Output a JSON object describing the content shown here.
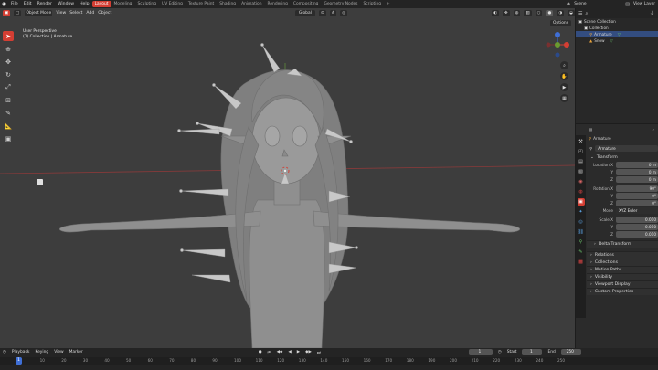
{
  "topbar": {
    "menus": [
      "File",
      "Edit",
      "Render",
      "Window",
      "Help"
    ],
    "workspaces": [
      {
        "label": "Layout",
        "active": true
      },
      {
        "label": "Modeling",
        "active": false
      },
      {
        "label": "Sculpting",
        "active": false
      },
      {
        "label": "UV Editing",
        "active": false
      },
      {
        "label": "Texture Paint",
        "active": false
      },
      {
        "label": "Shading",
        "active": false
      },
      {
        "label": "Animation",
        "active": false
      },
      {
        "label": "Rendering",
        "active": false
      },
      {
        "label": "Compositing",
        "active": false
      },
      {
        "label": "Geometry Nodes",
        "active": false
      },
      {
        "label": "Scripting",
        "active": false
      }
    ],
    "add_tab": "+",
    "scene": "Scene",
    "view_layer": "View Layer"
  },
  "viewport": {
    "mode": "Object Mode",
    "menus": [
      "View",
      "Select",
      "Add",
      "Object"
    ],
    "transform_orientation": "Global",
    "view_name": "User Perspective",
    "collection_path": "(1) Collection | Armature",
    "options": "Options",
    "gizmo": {
      "x": "X",
      "y": "Y",
      "z": "Z"
    }
  },
  "outliner": {
    "rows": [
      {
        "label": "Scene Collection",
        "indent": 0,
        "selected": false
      },
      {
        "label": "Collection",
        "indent": 1,
        "selected": false
      },
      {
        "label": "Armature",
        "indent": 2,
        "selected": true
      },
      {
        "label": "Snow",
        "indent": 2,
        "selected": false
      }
    ]
  },
  "properties": {
    "object_name": "Armature",
    "data_name": "Armature",
    "transform_header": "Transform",
    "location": {
      "label": "Location X",
      "x": "0 m",
      "y": "0 m",
      "z": "0 m"
    },
    "rotation": {
      "label": "Rotation X",
      "x": "90°",
      "y": "0°",
      "z": "0°"
    },
    "mode_label": "Mode",
    "mode_value": "XYZ Euler",
    "scale": {
      "label": "Scale X",
      "x": "0.010",
      "y": "0.010",
      "z": "0.010"
    },
    "axis_y": "Y",
    "axis_z": "Z",
    "delta_transform": "Delta Transform",
    "sections": [
      "Relations",
      "Collections",
      "Motion Paths",
      "Visibility",
      "Viewport Display",
      "Custom Properties"
    ]
  },
  "timeline": {
    "menus": [
      "Playback",
      "Keying",
      "View",
      "Marker"
    ],
    "current_frame": "1",
    "start_label": "Start",
    "start": "1",
    "end_label": "End",
    "end": "250",
    "ticks": [
      "1",
      "10",
      "20",
      "30",
      "40",
      "50",
      "60",
      "70",
      "80",
      "90",
      "100",
      "110",
      "120",
      "130",
      "140",
      "150",
      "160",
      "170",
      "180",
      "190",
      "200",
      "210",
      "220",
      "230",
      "240",
      "250"
    ]
  },
  "colors": {
    "accent": "#d43e33",
    "selection": "#334d80",
    "viewport_bg": "#3d3d3d"
  }
}
